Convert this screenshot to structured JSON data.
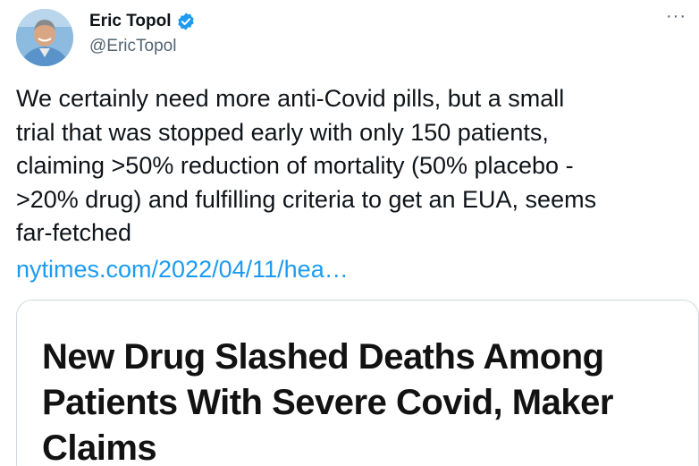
{
  "author": {
    "display_name": "Eric Topol",
    "handle": "@EricTopol",
    "verified_icon": "verified-badge-icon",
    "avatar_icon": "profile-photo"
  },
  "menu": {
    "more_label": "···"
  },
  "tweet": {
    "text": "We certainly need more anti-Covid pills, but a small\ntrial that was stopped early with only 150 patients,\nclaiming  >50% reduction of mortality (50% placebo -\n>20% drug) and fulfilling criteria to get an EUA, seems\nfar-fetched",
    "link_text": "nytimes.com/2022/04/11/hea…"
  },
  "card": {
    "headline": "New Drug Slashed Deaths Among Patients With Severe Covid, Maker Claims"
  },
  "colors": {
    "link": "#1d9bf0",
    "verified": "#1d9bf0",
    "secondary_text": "#536471",
    "border": "#cfd9de"
  }
}
